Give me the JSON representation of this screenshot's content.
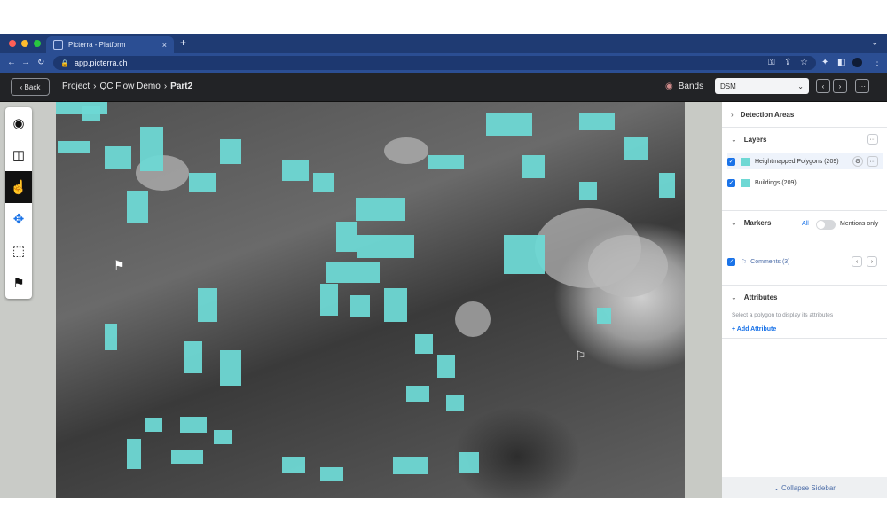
{
  "browser": {
    "tab_title": "Picterra - Platform",
    "tab_close": "×",
    "new_tab": "+",
    "url": "app.picterra.ch"
  },
  "header": {
    "back_label": "Back",
    "breadcrumb": [
      "Project",
      "QC Flow Demo",
      "Part2"
    ],
    "bands_label": "Bands",
    "bands_value": "DSM"
  },
  "sidebar": {
    "detection_areas": "Detection Areas",
    "layers": {
      "title": "Layers",
      "items": [
        {
          "label": "Heightmapped Polygons (209)"
        },
        {
          "label": "Buildings (209)"
        }
      ]
    },
    "markers": {
      "title": "Markers",
      "filter_all": "All",
      "mentions_only": "Mentions only",
      "comments": "Comments (3)"
    },
    "attributes": {
      "title": "Attributes",
      "hint": "Select a polygon to display its attributes",
      "add": "+ Add Attribute"
    },
    "collapse": "Collapse Sidebar"
  },
  "colors": {
    "polygon": "#6ed8d4",
    "accent": "#1a73e8",
    "header": "#222326",
    "browser_bar": "#2b4e93"
  },
  "icons": {
    "tools": [
      "eye-icon",
      "split-view-icon",
      "hand-pointer-icon",
      "move-node-icon",
      "select-rect-icon",
      "flag-icon"
    ]
  }
}
